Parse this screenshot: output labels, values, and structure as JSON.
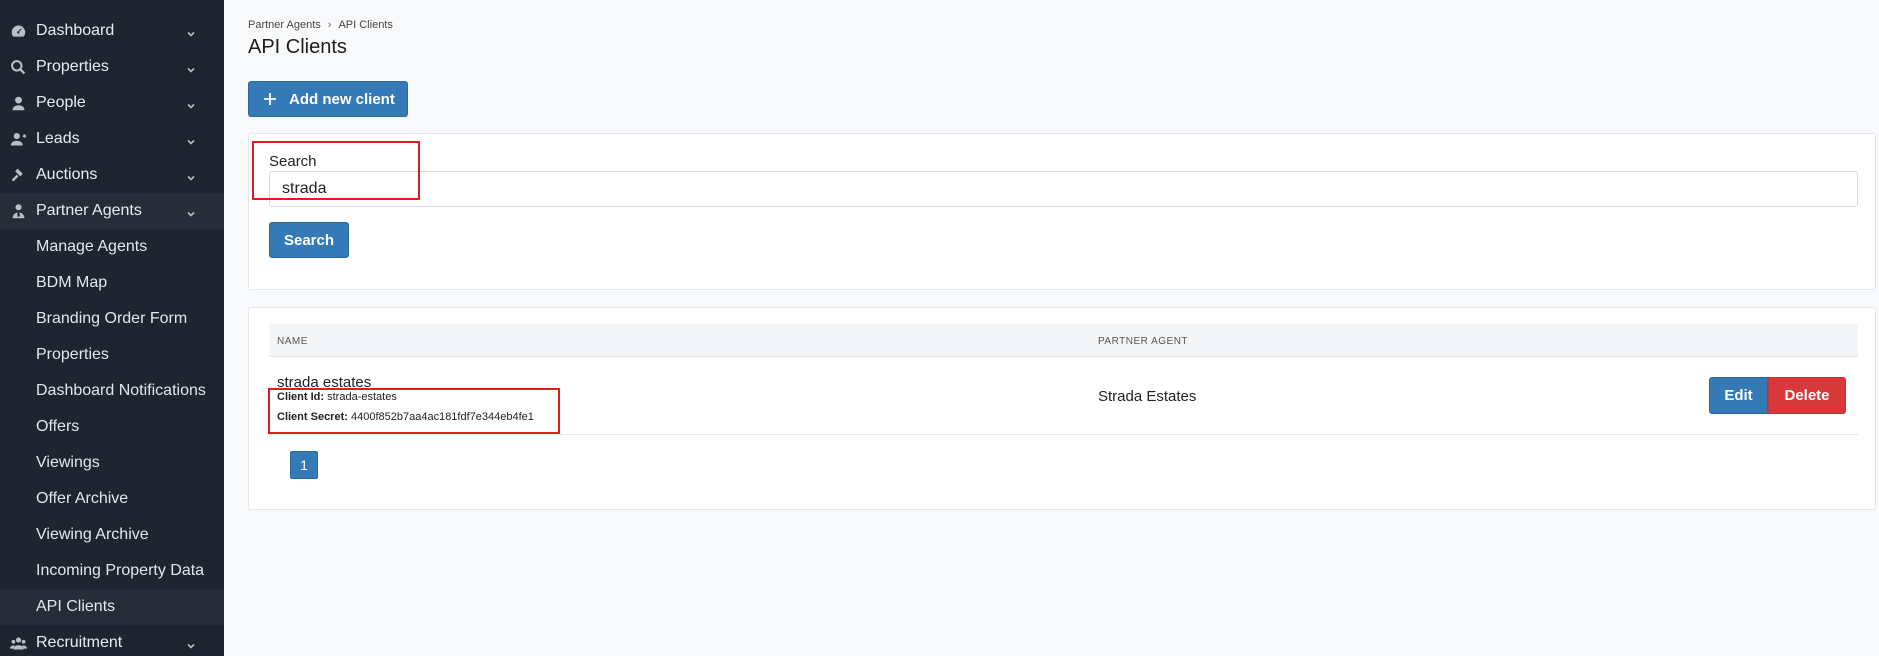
{
  "sidebar": {
    "items": [
      {
        "label": "Dashboard",
        "icon": "dashboard-icon"
      },
      {
        "label": "Properties",
        "icon": "search-icon"
      },
      {
        "label": "People",
        "icon": "person-icon"
      },
      {
        "label": "Leads",
        "icon": "user-plus-icon"
      },
      {
        "label": "Auctions",
        "icon": "gavel-icon"
      },
      {
        "label": "Partner Agents",
        "icon": "agent-icon"
      },
      {
        "label": "Recruitment",
        "icon": "users-icon"
      }
    ],
    "sub_items": [
      "Manage Agents",
      "BDM Map",
      "Branding Order Form",
      "Properties",
      "Dashboard Notifications",
      "Offers",
      "Viewings",
      "Offer Archive",
      "Viewing Archive",
      "Incoming Property Data",
      "API Clients"
    ]
  },
  "breadcrumb": {
    "parent": "Partner Agents",
    "separator": "›",
    "current": "API Clients"
  },
  "page": {
    "title": "API Clients",
    "add_button": "Add new client"
  },
  "search": {
    "label": "Search",
    "value": "strada",
    "button": "Search"
  },
  "table": {
    "headers": [
      "NAME",
      "PARTNER AGENT"
    ],
    "rows": [
      {
        "name": "strada estates",
        "client_id_label": "Client Id:",
        "client_id": "strada-estates",
        "client_secret_label": "Client Secret:",
        "client_secret": "4400f852b7aa4ac181fdf7e344eb4fe1",
        "partner_agent": "Strada Estates",
        "edit": "Edit",
        "delete": "Delete"
      }
    ]
  },
  "pagination": {
    "current": "1"
  },
  "colors": {
    "sidebar_bg": "#1f2530",
    "primary": "#337ab7",
    "danger": "#d9383a",
    "highlight": "#e21b1b"
  }
}
